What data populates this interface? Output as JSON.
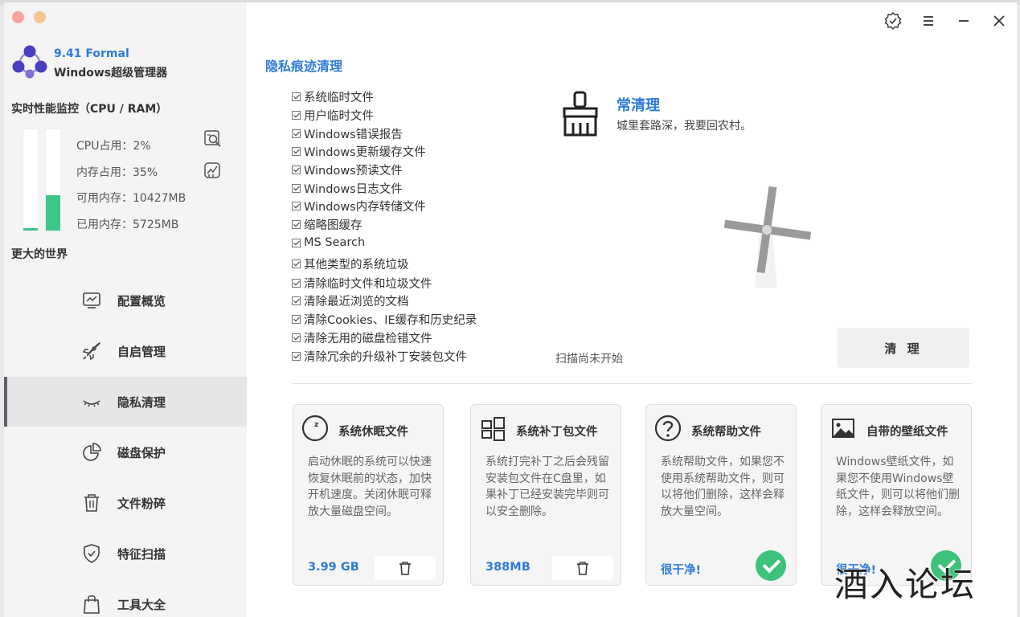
{
  "app": {
    "version": "9.41 Formal",
    "name": "Windows超级管理器"
  },
  "monitor": {
    "title": "实时性能监控（CPU / RAM）",
    "cpu_usage": "CPU占用：2%",
    "mem_usage": "内存占用：35%",
    "mem_available": "可用内存：10427MB",
    "mem_used": "已用内存：5725MB",
    "cpu_percent": 2,
    "mem_percent": 35
  },
  "world_title": "更大的世界",
  "nav": [
    {
      "label": "配置概览",
      "icon": "monitor-chart-icon"
    },
    {
      "label": "自启管理",
      "icon": "rocket-icon"
    },
    {
      "label": "隐私清理",
      "icon": "closed-eye-icon",
      "active": true
    },
    {
      "label": "磁盘保护",
      "icon": "pie-chart-icon"
    },
    {
      "label": "文件粉碎",
      "icon": "trash-icon"
    },
    {
      "label": "特征扫描",
      "icon": "shield-check-icon"
    },
    {
      "label": "工具大全",
      "icon": "bag-icon"
    }
  ],
  "page_title": "隐私痕迹清理",
  "checklist": [
    "系统临时文件",
    "用户临时文件",
    "Windows错误报告",
    "Windows更新缓存文件",
    "Windows预读文件",
    "Windows日志文件",
    "Windows内存转储文件",
    "缩略图缓存",
    "MS Search",
    "其他类型的系统垃圾",
    "清除临时文件和垃圾文件",
    "清除最近浏览的文档",
    "清除Cookies、IE缓存和历史纪录",
    "清除无用的磁盘检错文件",
    "清除冗余的升级补丁安装包文件"
  ],
  "clean_panel": {
    "title": "常清理",
    "subtitle": "城里套路深，我要回农村。",
    "status": "扫描尚未开始",
    "button": "清 理"
  },
  "cards": [
    {
      "title": "系统休眠文件",
      "desc": "启动休眠的系统可以快速恢复休眠前的状态，加快开机速度。关闭休眠可释放大量磁盘空间。",
      "size": "3.99 GB",
      "state": "trash",
      "icon": "sleep-icon"
    },
    {
      "title": "系统补丁包文件",
      "desc": "系统打完补丁之后会残留安装包文件在C盘里，如果补丁已经安装完毕则可以安全删除。",
      "size": "388MB",
      "state": "trash",
      "icon": "windows-grid-icon"
    },
    {
      "title": "系统帮助文件",
      "desc": "系统帮助文件，如果您不使用系统帮助文件，则可以将他们删除，这样会释放大量空间。",
      "size": "很干净!",
      "state": "clean",
      "icon": "question-icon"
    },
    {
      "title": "自带的壁纸文件",
      "desc": "Windows壁纸文件，如果您不使用Windows壁纸文件，则可以将他们删除，这样会释放空间。",
      "size": "很干净!",
      "state": "clean",
      "icon": "image-icon"
    }
  ],
  "watermark": "酒入论坛",
  "colors": {
    "accent": "#2f7bd9",
    "green": "#3cc27a",
    "gauge": "#3ec68a"
  }
}
